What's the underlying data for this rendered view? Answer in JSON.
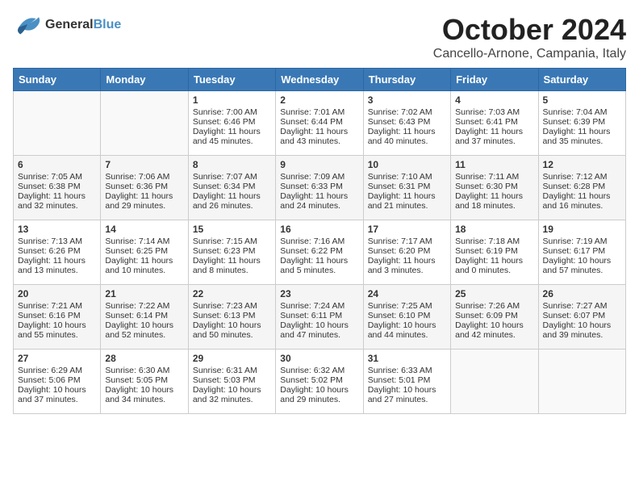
{
  "header": {
    "logo_line1": "General",
    "logo_line2": "Blue",
    "title": "October 2024",
    "subtitle": "Cancello-Arnone, Campania, Italy"
  },
  "days_of_week": [
    "Sunday",
    "Monday",
    "Tuesday",
    "Wednesday",
    "Thursday",
    "Friday",
    "Saturday"
  ],
  "weeks": [
    [
      {
        "day": "",
        "sunrise": "",
        "sunset": "",
        "daylight": ""
      },
      {
        "day": "",
        "sunrise": "",
        "sunset": "",
        "daylight": ""
      },
      {
        "day": "1",
        "sunrise": "Sunrise: 7:00 AM",
        "sunset": "Sunset: 6:46 PM",
        "daylight": "Daylight: 11 hours and 45 minutes."
      },
      {
        "day": "2",
        "sunrise": "Sunrise: 7:01 AM",
        "sunset": "Sunset: 6:44 PM",
        "daylight": "Daylight: 11 hours and 43 minutes."
      },
      {
        "day": "3",
        "sunrise": "Sunrise: 7:02 AM",
        "sunset": "Sunset: 6:43 PM",
        "daylight": "Daylight: 11 hours and 40 minutes."
      },
      {
        "day": "4",
        "sunrise": "Sunrise: 7:03 AM",
        "sunset": "Sunset: 6:41 PM",
        "daylight": "Daylight: 11 hours and 37 minutes."
      },
      {
        "day": "5",
        "sunrise": "Sunrise: 7:04 AM",
        "sunset": "Sunset: 6:39 PM",
        "daylight": "Daylight: 11 hours and 35 minutes."
      }
    ],
    [
      {
        "day": "6",
        "sunrise": "Sunrise: 7:05 AM",
        "sunset": "Sunset: 6:38 PM",
        "daylight": "Daylight: 11 hours and 32 minutes."
      },
      {
        "day": "7",
        "sunrise": "Sunrise: 7:06 AM",
        "sunset": "Sunset: 6:36 PM",
        "daylight": "Daylight: 11 hours and 29 minutes."
      },
      {
        "day": "8",
        "sunrise": "Sunrise: 7:07 AM",
        "sunset": "Sunset: 6:34 PM",
        "daylight": "Daylight: 11 hours and 26 minutes."
      },
      {
        "day": "9",
        "sunrise": "Sunrise: 7:09 AM",
        "sunset": "Sunset: 6:33 PM",
        "daylight": "Daylight: 11 hours and 24 minutes."
      },
      {
        "day": "10",
        "sunrise": "Sunrise: 7:10 AM",
        "sunset": "Sunset: 6:31 PM",
        "daylight": "Daylight: 11 hours and 21 minutes."
      },
      {
        "day": "11",
        "sunrise": "Sunrise: 7:11 AM",
        "sunset": "Sunset: 6:30 PM",
        "daylight": "Daylight: 11 hours and 18 minutes."
      },
      {
        "day": "12",
        "sunrise": "Sunrise: 7:12 AM",
        "sunset": "Sunset: 6:28 PM",
        "daylight": "Daylight: 11 hours and 16 minutes."
      }
    ],
    [
      {
        "day": "13",
        "sunrise": "Sunrise: 7:13 AM",
        "sunset": "Sunset: 6:26 PM",
        "daylight": "Daylight: 11 hours and 13 minutes."
      },
      {
        "day": "14",
        "sunrise": "Sunrise: 7:14 AM",
        "sunset": "Sunset: 6:25 PM",
        "daylight": "Daylight: 11 hours and 10 minutes."
      },
      {
        "day": "15",
        "sunrise": "Sunrise: 7:15 AM",
        "sunset": "Sunset: 6:23 PM",
        "daylight": "Daylight: 11 hours and 8 minutes."
      },
      {
        "day": "16",
        "sunrise": "Sunrise: 7:16 AM",
        "sunset": "Sunset: 6:22 PM",
        "daylight": "Daylight: 11 hours and 5 minutes."
      },
      {
        "day": "17",
        "sunrise": "Sunrise: 7:17 AM",
        "sunset": "Sunset: 6:20 PM",
        "daylight": "Daylight: 11 hours and 3 minutes."
      },
      {
        "day": "18",
        "sunrise": "Sunrise: 7:18 AM",
        "sunset": "Sunset: 6:19 PM",
        "daylight": "Daylight: 11 hours and 0 minutes."
      },
      {
        "day": "19",
        "sunrise": "Sunrise: 7:19 AM",
        "sunset": "Sunset: 6:17 PM",
        "daylight": "Daylight: 10 hours and 57 minutes."
      }
    ],
    [
      {
        "day": "20",
        "sunrise": "Sunrise: 7:21 AM",
        "sunset": "Sunset: 6:16 PM",
        "daylight": "Daylight: 10 hours and 55 minutes."
      },
      {
        "day": "21",
        "sunrise": "Sunrise: 7:22 AM",
        "sunset": "Sunset: 6:14 PM",
        "daylight": "Daylight: 10 hours and 52 minutes."
      },
      {
        "day": "22",
        "sunrise": "Sunrise: 7:23 AM",
        "sunset": "Sunset: 6:13 PM",
        "daylight": "Daylight: 10 hours and 50 minutes."
      },
      {
        "day": "23",
        "sunrise": "Sunrise: 7:24 AM",
        "sunset": "Sunset: 6:11 PM",
        "daylight": "Daylight: 10 hours and 47 minutes."
      },
      {
        "day": "24",
        "sunrise": "Sunrise: 7:25 AM",
        "sunset": "Sunset: 6:10 PM",
        "daylight": "Daylight: 10 hours and 44 minutes."
      },
      {
        "day": "25",
        "sunrise": "Sunrise: 7:26 AM",
        "sunset": "Sunset: 6:09 PM",
        "daylight": "Daylight: 10 hours and 42 minutes."
      },
      {
        "day": "26",
        "sunrise": "Sunrise: 7:27 AM",
        "sunset": "Sunset: 6:07 PM",
        "daylight": "Daylight: 10 hours and 39 minutes."
      }
    ],
    [
      {
        "day": "27",
        "sunrise": "Sunrise: 6:29 AM",
        "sunset": "Sunset: 5:06 PM",
        "daylight": "Daylight: 10 hours and 37 minutes."
      },
      {
        "day": "28",
        "sunrise": "Sunrise: 6:30 AM",
        "sunset": "Sunset: 5:05 PM",
        "daylight": "Daylight: 10 hours and 34 minutes."
      },
      {
        "day": "29",
        "sunrise": "Sunrise: 6:31 AM",
        "sunset": "Sunset: 5:03 PM",
        "daylight": "Daylight: 10 hours and 32 minutes."
      },
      {
        "day": "30",
        "sunrise": "Sunrise: 6:32 AM",
        "sunset": "Sunset: 5:02 PM",
        "daylight": "Daylight: 10 hours and 29 minutes."
      },
      {
        "day": "31",
        "sunrise": "Sunrise: 6:33 AM",
        "sunset": "Sunset: 5:01 PM",
        "daylight": "Daylight: 10 hours and 27 minutes."
      },
      {
        "day": "",
        "sunrise": "",
        "sunset": "",
        "daylight": ""
      },
      {
        "day": "",
        "sunrise": "",
        "sunset": "",
        "daylight": ""
      }
    ]
  ]
}
